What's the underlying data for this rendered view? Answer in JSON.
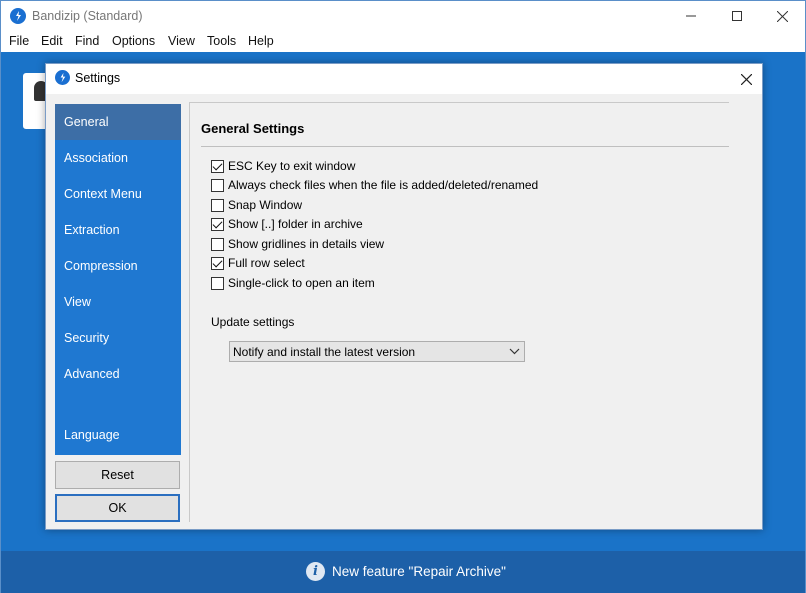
{
  "app": {
    "title": "Bandizip (Standard)",
    "menu": [
      "File",
      "Edit",
      "Find",
      "Options",
      "View",
      "Tools",
      "Help"
    ]
  },
  "status": {
    "text": "New feature \"Repair Archive\"",
    "info_glyph": "i"
  },
  "dialog": {
    "title": "Settings",
    "sidebar": {
      "items": [
        {
          "label": "General",
          "active": true
        },
        {
          "label": "Association",
          "active": false
        },
        {
          "label": "Context Menu",
          "active": false
        },
        {
          "label": "Extraction",
          "active": false
        },
        {
          "label": "Compression",
          "active": false
        },
        {
          "label": "View",
          "active": false
        },
        {
          "label": "Security",
          "active": false
        },
        {
          "label": "Advanced",
          "active": false
        },
        {
          "label": "Language",
          "active": false
        }
      ]
    },
    "buttons": {
      "reset": "Reset",
      "ok": "OK"
    },
    "panel": {
      "heading": "General Settings",
      "options": [
        {
          "label": "ESC Key to exit window",
          "checked": true
        },
        {
          "label": "Always check files when the file is added/deleted/renamed",
          "checked": false
        },
        {
          "label": "Snap Window",
          "checked": false
        },
        {
          "label": "Show [..] folder in archive",
          "checked": true
        },
        {
          "label": "Show gridlines in details view",
          "checked": false
        },
        {
          "label": "Full row select",
          "checked": true
        },
        {
          "label": "Single-click to open an item",
          "checked": false
        }
      ],
      "update_label": "Update settings",
      "update_value": "Notify and install the latest version"
    }
  },
  "colors": {
    "accent": "#1a73c8",
    "sidebar": "#1f78d1",
    "sidebar_active": "#3d6ea6",
    "statusbar": "#1d60a8"
  }
}
